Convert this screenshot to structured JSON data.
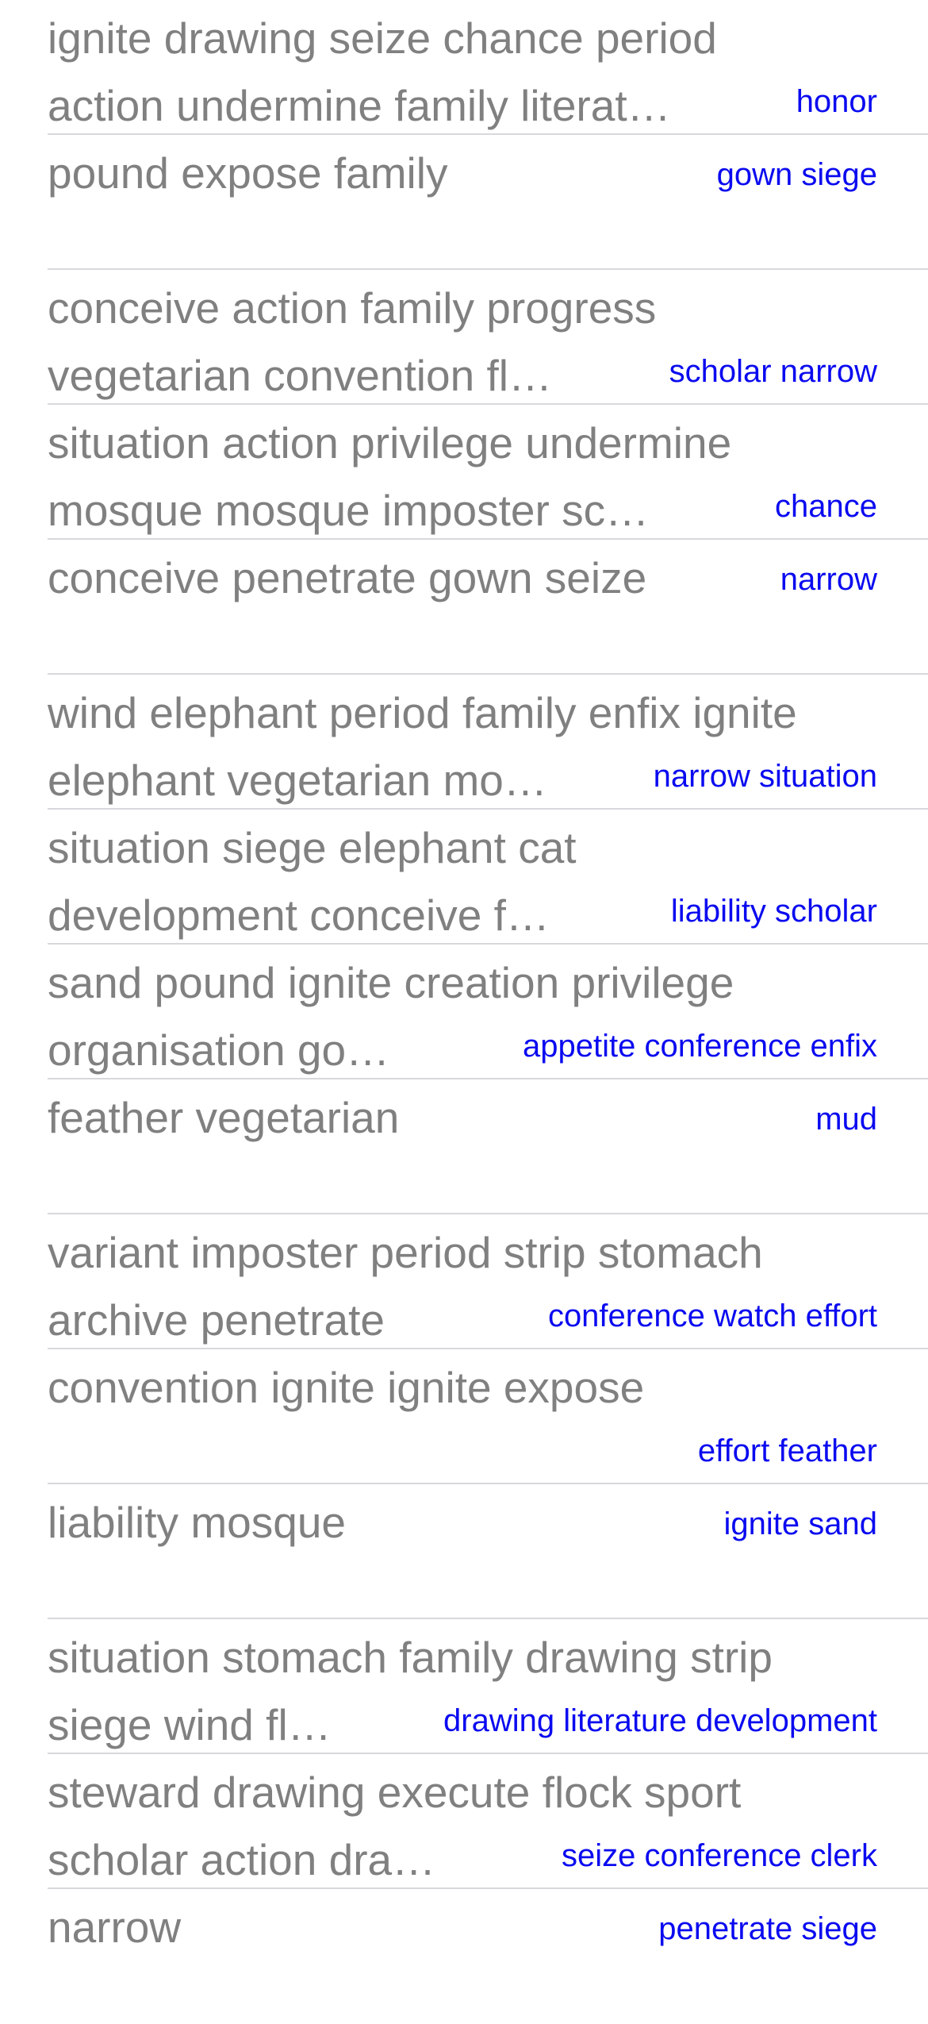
{
  "rows": [
    {
      "title_line1": "ignite drawing seize chance period",
      "title_line2": "action undermine family literat…",
      "tag": "honor",
      "tag_position": "bottom"
    },
    {
      "title_line1": "pound expose family",
      "title_line2": "",
      "tag": "gown siege",
      "tag_position": "top"
    },
    {
      "title_line1": "conceive action family progress",
      "title_line2": "vegetarian convention fl…",
      "tag": "scholar narrow",
      "tag_position": "bottom"
    },
    {
      "title_line1": "situation action privilege undermine",
      "title_line2": "mosque mosque imposter sc…",
      "tag": "chance",
      "tag_position": "bottom"
    },
    {
      "title_line1": "conceive penetrate gown seize",
      "title_line2": "",
      "tag": "narrow",
      "tag_position": "top"
    },
    {
      "title_line1": "wind elephant period family enfix ignite",
      "title_line2": "elephant vegetarian mo…",
      "tag": "narrow situation",
      "tag_position": "bottom"
    },
    {
      "title_line1": "situation siege elephant cat",
      "title_line2": "development conceive f…",
      "tag": "liability scholar",
      "tag_position": "bottom"
    },
    {
      "title_line1": "sand pound ignite creation privilege",
      "title_line2": "organisation go…",
      "tag": "appetite conference enfix",
      "tag_position": "bottom"
    },
    {
      "title_line1": "feather vegetarian",
      "title_line2": "",
      "tag": "mud",
      "tag_position": "top"
    },
    {
      "title_line1": "variant imposter period strip stomach",
      "title_line2": "archive penetrate",
      "tag": "conference watch effort",
      "tag_position": "bottom"
    },
    {
      "title_line1": "convention ignite ignite expose",
      "title_line2": "",
      "tag": "effort feather",
      "tag_position": "bottom"
    },
    {
      "title_line1": "liability mosque",
      "title_line2": "",
      "tag": "ignite sand",
      "tag_position": "top"
    },
    {
      "title_line1": "situation stomach family drawing strip",
      "title_line2": "siege wind fl…",
      "tag": "drawing literature development",
      "tag_position": "bottom"
    },
    {
      "title_line1": "steward drawing execute flock sport",
      "title_line2": "scholar action dra…",
      "tag": "seize conference clerk",
      "tag_position": "bottom"
    },
    {
      "title_line1": "narrow",
      "title_line2": "",
      "tag": "penetrate siege",
      "tag_position": "top"
    }
  ],
  "colors": {
    "title": "#808080",
    "tag": "#0a0af0",
    "separator": "#d8d8dc",
    "background": "#ffffff"
  }
}
